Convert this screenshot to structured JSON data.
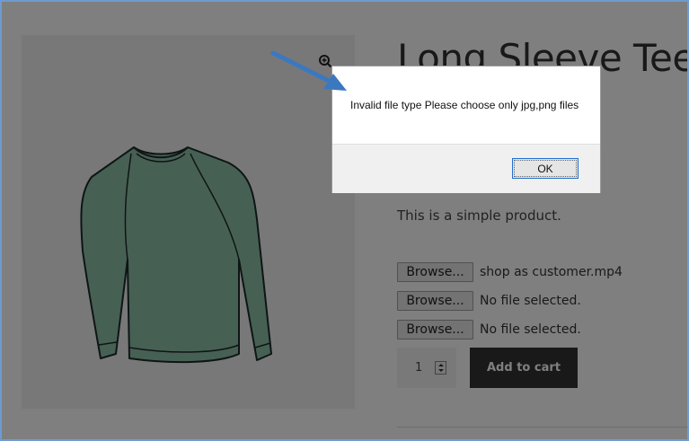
{
  "product": {
    "title": "Long Sleeve Tee",
    "description": "This is a simple product.",
    "price_partial": "!"
  },
  "uploads": [
    {
      "button_label": "Browse...",
      "file": "shop as customer.mp4"
    },
    {
      "button_label": "Browse...",
      "file": "No file selected."
    },
    {
      "button_label": "Browse...",
      "file": "No file selected."
    }
  ],
  "cart": {
    "quantity": "1",
    "add_label": "Add to cart"
  },
  "dialog": {
    "message": "Invalid file type Please choose only jpg,png files",
    "ok_label": "OK"
  },
  "colors": {
    "arrow": "#3b78c0",
    "add_to_cart_bg": "#333333",
    "tee_fill": "#8fc0a9",
    "frame_border": "#6e9bd0"
  },
  "icons": {
    "zoom": "zoom-in-icon",
    "arrow": "annotation-arrow-icon"
  }
}
